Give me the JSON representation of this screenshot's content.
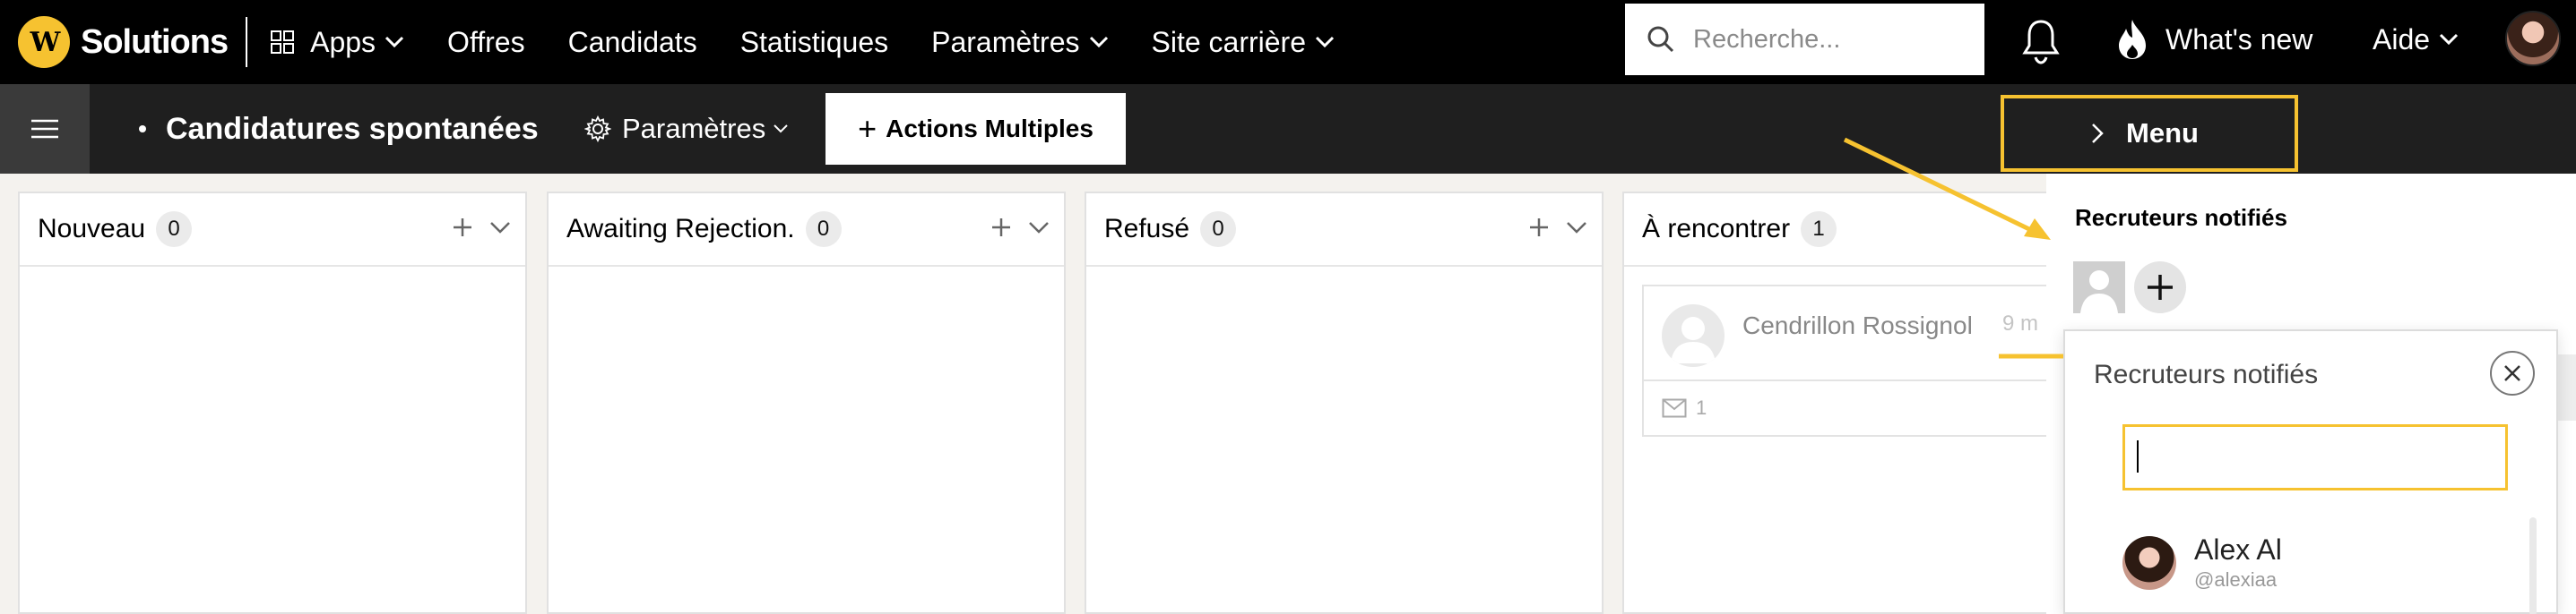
{
  "topnav": {
    "logo_mark": "W",
    "logo_text": "Solutions",
    "items": [
      {
        "label": "Apps",
        "icon": "grid-icon",
        "dropdown": true
      },
      {
        "label": "Offres",
        "dropdown": false
      },
      {
        "label": "Candidats",
        "dropdown": false
      },
      {
        "label": "Statistiques",
        "dropdown": false
      },
      {
        "label": "Paramètres",
        "dropdown": true
      },
      {
        "label": "Site carrière",
        "dropdown": true
      }
    ],
    "search_placeholder": "Recherche...",
    "whats_new": "What's new",
    "help": "Aide"
  },
  "subbar": {
    "title": "Candidatures spontanées",
    "params_label": "Paramètres",
    "actions_label": "Actions Multiples",
    "menu_label": "Menu"
  },
  "columns": [
    {
      "title": "Nouveau",
      "count": "0",
      "cards": []
    },
    {
      "title": "Awaiting Rejection.",
      "count": "0",
      "cards": []
    },
    {
      "title": "Refusé",
      "count": "0",
      "cards": []
    },
    {
      "title": "À rencontrer",
      "count": "1",
      "cards": [
        {
          "name": "Cendrillon Rossignol",
          "time": "9 m",
          "messages": "1"
        }
      ]
    }
  ],
  "panel": {
    "title": "Recruteurs notifiés",
    "popup": {
      "title": "Recruteurs notifiés",
      "input_value": "",
      "results": [
        {
          "name": "Alex Al",
          "handle": "@alexiaa"
        }
      ]
    }
  },
  "colors": {
    "accent": "#f6c230",
    "topbar_bg": "#000000",
    "subbar_bg": "#1f1f1f",
    "board_bg": "#f4f2ee"
  }
}
